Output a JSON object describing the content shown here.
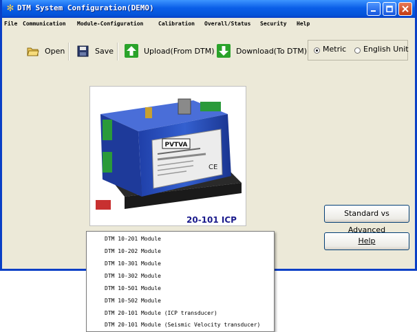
{
  "window": {
    "title": "DTM System Configuration(DEMO)"
  },
  "menu": {
    "items": [
      "File",
      "Communication",
      "Module-Configuration",
      "Calibration",
      "Overall/Status",
      "Security",
      "Help"
    ]
  },
  "toolbar": {
    "open_label": "Open",
    "save_label": "Save",
    "upload_label": "Upload(From DTM)",
    "download_label": "Download(To DTM)"
  },
  "units": {
    "metric_label": "Metric",
    "english_label": "English Unit",
    "selected": "Metric"
  },
  "module_image": {
    "brand": "PVTVA",
    "caption": "20-101 ICP"
  },
  "buttons": {
    "standard_vs_advanced": "Standard vs Advanced",
    "help": "Help"
  },
  "module_list": {
    "items": [
      "DTM 10-201 Module",
      "DTM 10-202 Module",
      "DTM 10-301 Module",
      "DTM 10-302 Module",
      "DTM 10-501 Module",
      "DTM 10-502 Module",
      "DTM 20-101 Module (ICP transducer)",
      "DTM 20-101 Module (Seismic Velocity transducer)"
    ]
  },
  "colors": {
    "titlebar": "#0a5ee8",
    "window_bg": "#ece9d8",
    "close_button": "#c23a12",
    "caption_text": "#1a1a8c",
    "arrow_icon_green": "#2aa32a"
  }
}
